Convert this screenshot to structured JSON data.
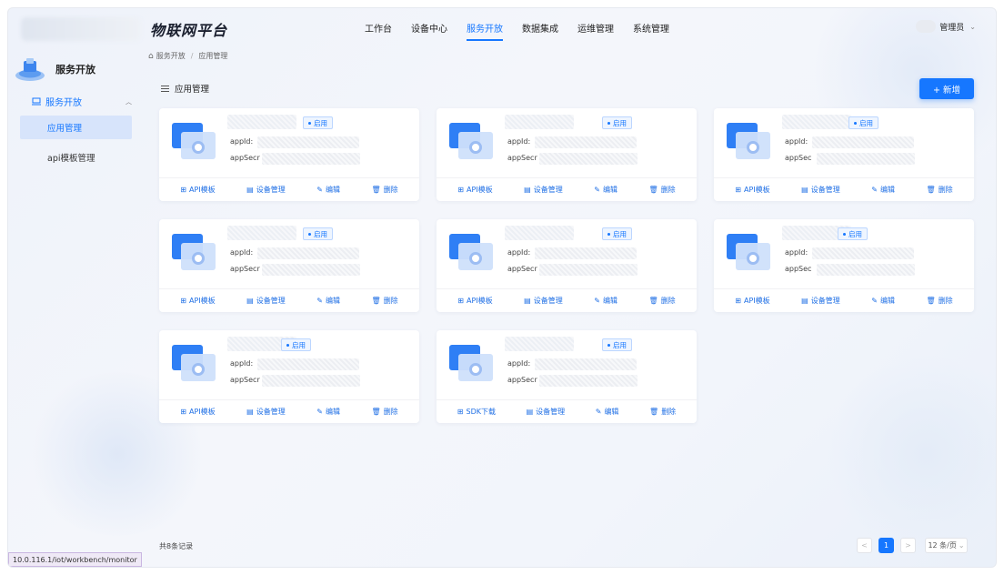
{
  "header": {
    "brand": "物联网平台",
    "nav": [
      "工作台",
      "设备中心",
      "服务开放",
      "数据集成",
      "运维管理",
      "系统管理"
    ],
    "active_nav": 2,
    "user": "管理员"
  },
  "sidebar": {
    "title": "服务开放",
    "group": "服务开放",
    "items": [
      {
        "label": "应用管理",
        "active": true
      },
      {
        "label": "api模板管理",
        "active": false
      }
    ]
  },
  "breadcrumb": [
    "服务开放",
    "应用管理"
  ],
  "section_title": "应用管理",
  "add_button": "+ 新增",
  "cards": [
    {
      "status": "启用",
      "appid_label": "appId:",
      "secret_label": "appSecr",
      "actions": [
        "API模板",
        "设备管理",
        "编辑",
        "删除"
      ]
    },
    {
      "status": "启用",
      "appid_label": "appId:",
      "secret_label": "appSecr",
      "actions": [
        "API模板",
        "设备管理",
        "编辑",
        "删除"
      ]
    },
    {
      "status": "启用",
      "appid_label": "appId:",
      "secret_label": "appSec",
      "actions": [
        "API模板",
        "设备管理",
        "编辑",
        "删除"
      ]
    },
    {
      "status": "启用",
      "appid_label": "appId:",
      "secret_label": "appSecr",
      "actions": [
        "API模板",
        "设备管理",
        "编辑",
        "删除"
      ]
    },
    {
      "status": "启用",
      "appid_label": "appId:",
      "secret_label": "appSecr",
      "actions": [
        "API模板",
        "设备管理",
        "编辑",
        "删除"
      ]
    },
    {
      "status": "启用",
      "appid_label": "appId:",
      "secret_label": "appSec",
      "actions": [
        "API模板",
        "设备管理",
        "编辑",
        "删除"
      ]
    },
    {
      "status": "启用",
      "appid_label": "appId:",
      "secret_label": "appSecr",
      "actions": [
        "API模板",
        "设备管理",
        "编辑",
        "删除"
      ]
    },
    {
      "status": "启用",
      "appid_label": "appId:",
      "secret_label": "appSecr",
      "actions": [
        "SDK下载",
        "设备管理",
        "编辑",
        "删除"
      ]
    }
  ],
  "footer": {
    "total": "共8条记录",
    "current_page": "1",
    "prev": "<",
    "next": ">",
    "page_size": "12 条/页"
  },
  "status_url": "10.0.116.1/iot/workbench/monitor",
  "colors": {
    "accent": "#1677ff",
    "active_bg": "#d7e4fb"
  }
}
